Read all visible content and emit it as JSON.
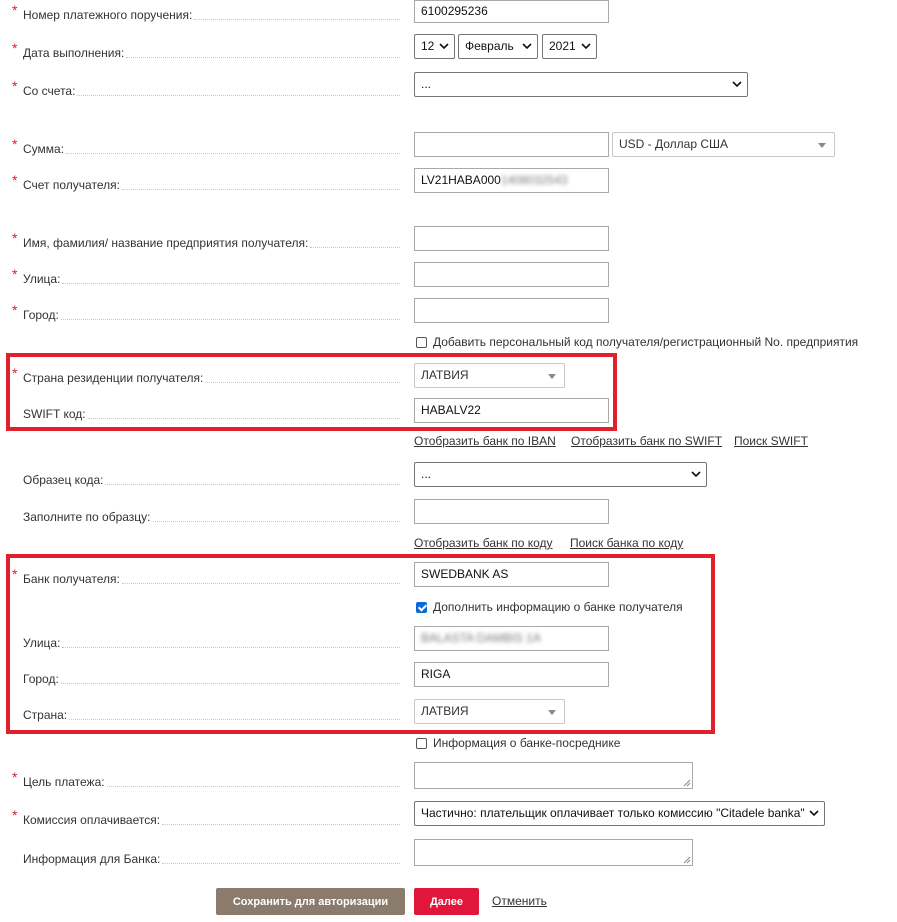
{
  "colors": {
    "required": "#d5202e",
    "highlight": "#e0202d",
    "save_button": "#8b7b6c",
    "next_button": "#e0163a",
    "checkbox_checked": "#0b6ad9"
  },
  "labels": {
    "payment_number": "Номер платежного поручения:",
    "execution_date": "Дата выполнения:",
    "from_account": "Со счета:",
    "amount": "Сумма:",
    "beneficiary_account": "Счет получателя:",
    "beneficiary_name": "Имя, фамилия/ название предприятия получателя:",
    "street": "Улица:",
    "city": "Город:",
    "residence_country": "Страна резиденции получателя:",
    "swift": "SWIFT код:",
    "code_sample": "Образец кода:",
    "fill_by_sample": "Заполните по образцу:",
    "beneficiary_bank": "Банк получателя:",
    "bank_street": "Улица:",
    "bank_city": "Город:",
    "bank_country": "Страна:",
    "purpose": "Цель платежа:",
    "commission": "Комиссия оплачивается:",
    "bank_info": "Информация для Банка:"
  },
  "values": {
    "payment_number": "6100295236",
    "day": "12",
    "month": "Февраль",
    "year": "2021",
    "from_account": "...",
    "amount": "",
    "currency": "USD - Доллар США",
    "account_visible": "LV21HABA000",
    "account_blurred": "1408032543",
    "beneficiary_name": "",
    "street": "",
    "city": "",
    "residence_country": "ЛАТВИЯ",
    "swift": "HABALV22",
    "code_sample": "...",
    "fill_by_sample": "",
    "beneficiary_bank": "SWEDBANK AS",
    "bank_street": "BALASTA DAMBIS 1A",
    "bank_city": "RIGA",
    "bank_country": "ЛАТВИЯ",
    "commission": "Частично: плательщик оплачивает только комиссию \"Citadele banka\""
  },
  "checkboxes": {
    "personal_code": {
      "label": "Добавить персональный код получателя/регистрационный No. предприятия",
      "checked": false
    },
    "bank_info": {
      "label": "Дополнить информацию о банке получателя",
      "checked": true
    },
    "intermediary": {
      "label": "Информация о банке-посреднике",
      "checked": false
    }
  },
  "links": {
    "bank_by_iban": "Отобразить банк по IBAN",
    "bank_by_swift": "Отобразить банк по SWIFT",
    "swift_search": "Поиск SWIFT",
    "bank_by_code": "Отобразить банк по коду",
    "bank_search_code": "Поиск банка по коду",
    "cancel": "Отменить"
  },
  "buttons": {
    "save": "Сохранить для авторизации",
    "next": "Далее"
  }
}
